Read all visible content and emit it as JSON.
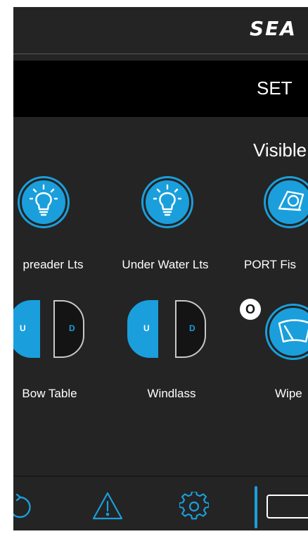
{
  "header": {
    "brand": "SEA",
    "title": "SET"
  },
  "section": {
    "label": "Visible"
  },
  "tiles": [
    {
      "label": "preader Lts",
      "icon": "lightbulb-icon"
    },
    {
      "label": "Under Water Lts",
      "icon": "lightbulb-icon"
    },
    {
      "label": "PORT Fis",
      "icon": "fish-icon"
    },
    {
      "label": "Bow Table",
      "icon": "up-down-toggle",
      "up": "U",
      "down": "D"
    },
    {
      "label": "Windlass",
      "icon": "up-down-toggle",
      "up": "U",
      "down": "D"
    },
    {
      "label": "Wipe",
      "icon": "wiper-icon",
      "badge": "O"
    }
  ],
  "bottom_nav": [
    {
      "icon": "refresh-icon"
    },
    {
      "icon": "warning-icon"
    },
    {
      "icon": "gear-icon"
    }
  ],
  "colors": {
    "accent": "#1a9fdc",
    "background": "#242424",
    "bar": "#000000"
  }
}
